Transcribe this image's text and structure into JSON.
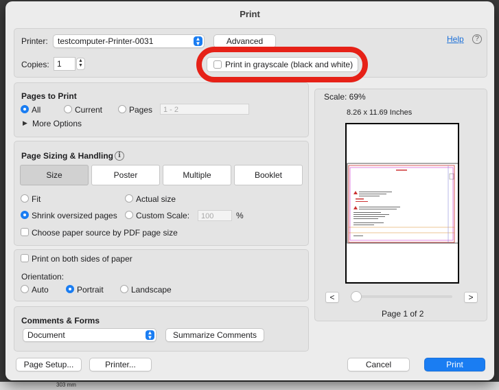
{
  "dialog": {
    "title": "Print"
  },
  "printer": {
    "label": "Printer:",
    "value": "testcomputer-Printer-0031",
    "advanced_label": "Advanced",
    "help_label": "Help",
    "help_icon": "question-mark-icon"
  },
  "copies": {
    "label": "Copies:",
    "value": "1"
  },
  "grayscale": {
    "label": "Print in grayscale (black and white)",
    "checked": false
  },
  "pages_to_print": {
    "heading": "Pages to Print",
    "options": [
      "All",
      "Current",
      "Pages"
    ],
    "selected": "All",
    "range_placeholder": "1 - 2",
    "more_options": "More Options"
  },
  "sizing": {
    "heading": "Page Sizing & Handling",
    "info_icon": "info-icon",
    "modes": [
      "Size",
      "Poster",
      "Multiple",
      "Booklet"
    ],
    "selected_mode": "Size",
    "fit": "Fit",
    "actual_size": "Actual size",
    "shrink": "Shrink oversized pages",
    "custom_scale": "Custom Scale:",
    "custom_scale_value": "100",
    "percent": "%",
    "selected_scaling": "Shrink oversized pages",
    "paper_source": "Choose paper source by PDF page size"
  },
  "duplex": {
    "label": "Print on both sides of paper"
  },
  "orientation": {
    "label": "Orientation:",
    "options": [
      "Auto",
      "Portrait",
      "Landscape"
    ],
    "selected": "Portrait"
  },
  "comments": {
    "heading": "Comments & Forms",
    "select_value": "Document",
    "summarize_label": "Summarize Comments"
  },
  "preview": {
    "scale_text": "Scale:  69%",
    "paper_size": "8.26 x 11.69 Inches",
    "prev_label": "<",
    "next_label": ">",
    "page_text": "Page 1 of 2",
    "progress": 0.0
  },
  "footer": {
    "page_setup": "Page Setup...",
    "printer": "Printer...",
    "cancel": "Cancel",
    "print": "Print"
  },
  "background": {
    "ruler_text": "303 mm"
  },
  "colors": {
    "accent": "#1a7df2",
    "highlight_ring": "#e62117"
  }
}
